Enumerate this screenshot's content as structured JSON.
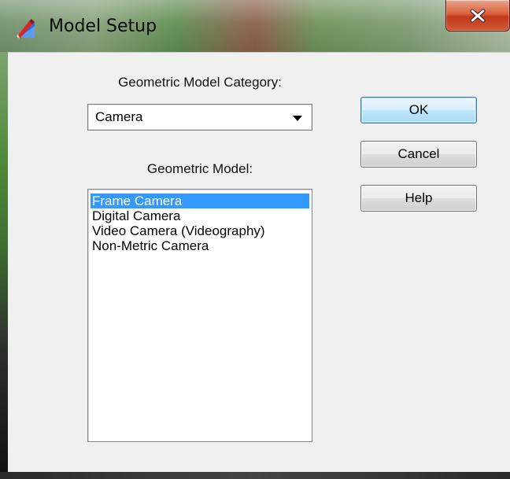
{
  "window": {
    "title": "Model Setup",
    "icon": "pencil-ruler-icon",
    "close_icon": "close-icon",
    "close_color": "#c7401f"
  },
  "form": {
    "category_label": "Geometric Model Category:",
    "category_value": "Camera",
    "model_label": "Geometric Model:",
    "models": [
      "Frame Camera",
      "Digital Camera",
      "Video Camera (Videography)",
      "Non-Metric Camera"
    ],
    "selected_model": "Frame Camera",
    "selection_color": "#3399ff"
  },
  "buttons": {
    "ok": "OK",
    "cancel": "Cancel",
    "help": "Help"
  }
}
